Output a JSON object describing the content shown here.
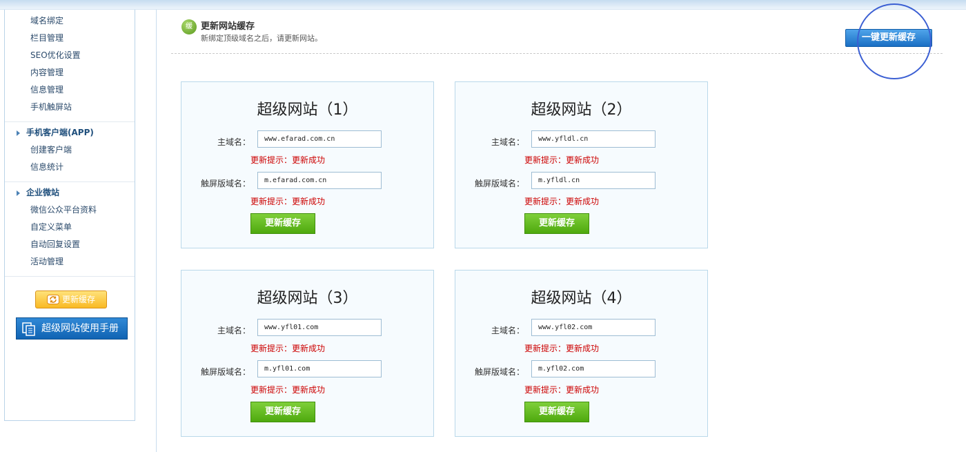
{
  "sidebar": {
    "group1_items": [
      "域名绑定",
      "栏目管理",
      "SEO优化设置",
      "内容管理",
      "信息管理",
      "手机触屏站"
    ],
    "group2": {
      "title": "手机客户端(APP)",
      "items": [
        "创建客户端",
        "信息统计"
      ]
    },
    "group3": {
      "title": "企业微站",
      "items": [
        "微信公众平台资料",
        "自定义菜单",
        "自动回复设置",
        "活动管理"
      ]
    },
    "refresh_button": "更新缓存",
    "manual_button": "超级网站使用手册"
  },
  "header": {
    "badge": "缓",
    "title": "更新网站缓存",
    "subtitle": "新绑定顶级域名之后，请更新网站。",
    "update_all_button": "一键更新缓存"
  },
  "sites": [
    {
      "title": "超级网站（1）",
      "main_label": "主域名：",
      "main_domain": "www.efarad.com.cn",
      "main_tip": "更新提示：更新成功",
      "touch_label": "触屏版域名：",
      "touch_domain": "m.efarad.com.cn",
      "touch_tip": "更新提示：更新成功",
      "button": "更新缓存"
    },
    {
      "title": "超级网站（2）",
      "main_label": "主域名：",
      "main_domain": "www.yfldl.cn",
      "main_tip": "更新提示：更新成功",
      "touch_label": "触屏版域名：",
      "touch_domain": "m.yfldl.cn",
      "touch_tip": "更新提示：更新成功",
      "button": "更新缓存"
    },
    {
      "title": "超级网站（3）",
      "main_label": "主域名：",
      "main_domain": "www.yfl01.com",
      "main_tip": "更新提示：更新成功",
      "touch_label": "触屏版域名：",
      "touch_domain": "m.yfl01.com",
      "touch_tip": "更新提示：更新成功",
      "button": "更新缓存"
    },
    {
      "title": "超级网站（4）",
      "main_label": "主域名：",
      "main_domain": "www.yfl02.com",
      "main_tip": "更新提示：更新成功",
      "touch_label": "触屏版域名：",
      "touch_domain": "m.yfl02.com",
      "touch_tip": "更新提示：更新成功",
      "button": "更新缓存"
    }
  ],
  "colors": {
    "tip": "#cc0000",
    "accent_blue": "#1a6fc4",
    "green": "#4ea90e"
  }
}
